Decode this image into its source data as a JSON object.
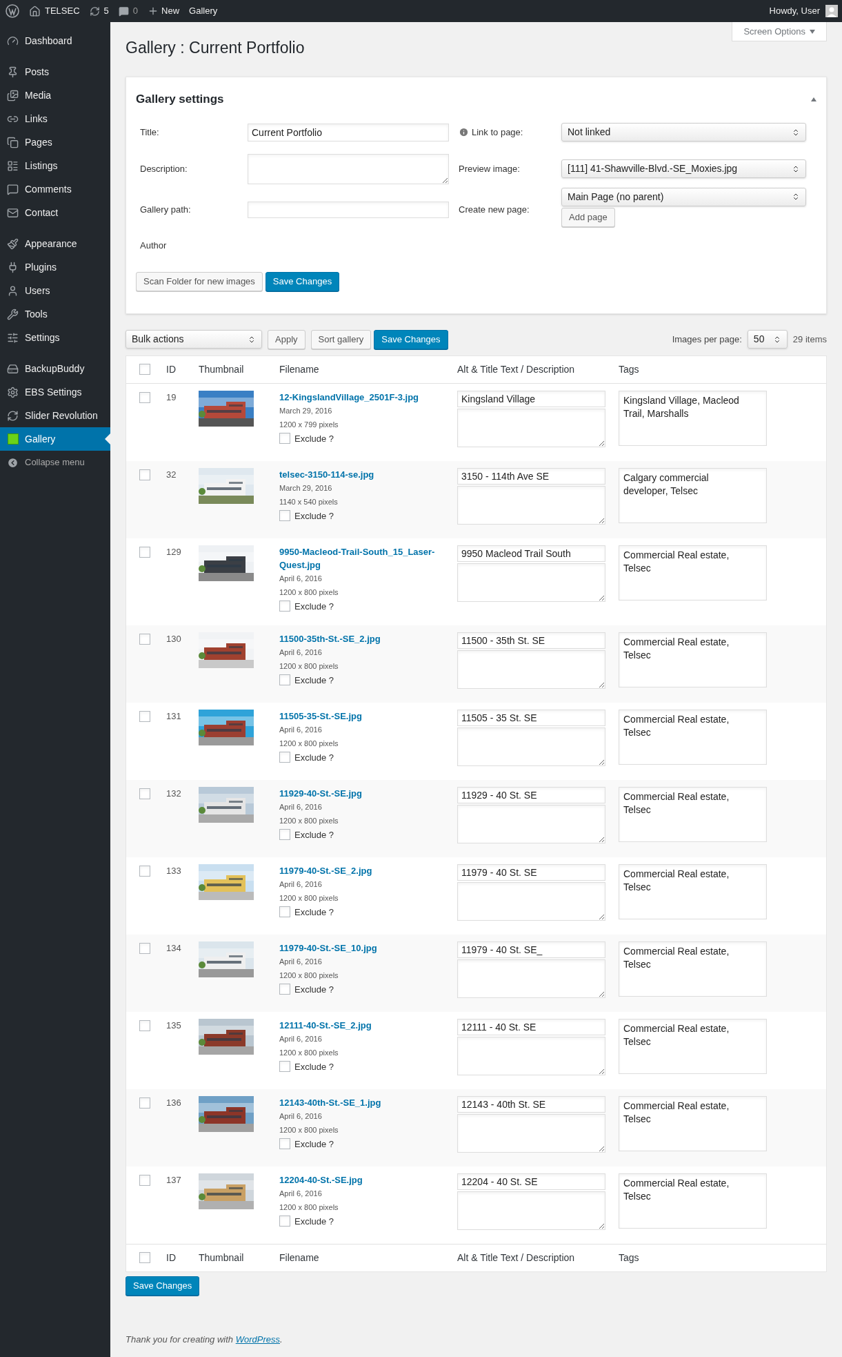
{
  "admin_bar": {
    "site": "TELSEC",
    "updates": "5",
    "comments": "0",
    "new": "New",
    "current": "Gallery",
    "greeting": "Howdy, User"
  },
  "sidebar": {
    "groups": [
      {
        "items": [
          {
            "label": "Dashboard",
            "kind": "dashboard",
            "selected": false
          }
        ]
      },
      {
        "items": [
          {
            "label": "Posts",
            "kind": "pin",
            "selected": false
          },
          {
            "label": "Media",
            "kind": "media",
            "selected": false
          },
          {
            "label": "Links",
            "kind": "link",
            "selected": false
          },
          {
            "label": "Pages",
            "kind": "pages",
            "selected": false
          },
          {
            "label": "Listings",
            "kind": "listings",
            "selected": false
          },
          {
            "label": "Comments",
            "kind": "comment",
            "selected": false
          },
          {
            "label": "Contact",
            "kind": "mail",
            "selected": false
          }
        ]
      },
      {
        "items": [
          {
            "label": "Appearance",
            "kind": "brush",
            "selected": false
          },
          {
            "label": "Plugins",
            "kind": "plug",
            "selected": false
          },
          {
            "label": "Users",
            "kind": "user",
            "selected": false
          },
          {
            "label": "Tools",
            "kind": "wrench",
            "selected": false
          },
          {
            "label": "Settings",
            "kind": "sliders",
            "selected": false
          }
        ]
      },
      {
        "items": [
          {
            "label": "BackupBuddy",
            "kind": "drive",
            "selected": false
          },
          {
            "label": "EBS Settings",
            "kind": "gear",
            "selected": false
          },
          {
            "label": "Slider Revolution",
            "kind": "refresh",
            "selected": false
          },
          {
            "label": "Gallery",
            "kind": "square",
            "selected": true
          }
        ]
      }
    ],
    "collapse": "Collapse menu"
  },
  "screen_options": "Screen Options",
  "page_title": "Gallery : Current Portfolio",
  "settings": {
    "heading": "Gallery settings",
    "title_label": "Title:",
    "title_value": "Current Portfolio",
    "description_label": "Description:",
    "path_label": "Gallery path:",
    "author_label": "Author",
    "link_label": "Link to page:",
    "link_value": "Not linked",
    "preview_label": "Preview image:",
    "preview_value": "[111] 41-Shawville-Blvd.-SE_Moxies.jpg",
    "create_label": "Create new page:",
    "create_value": "Main Page (no parent)",
    "add_page": "Add page",
    "scan_button": "Scan Folder for new images",
    "save_button": "Save Changes"
  },
  "toolbar": {
    "bulk": "Bulk actions",
    "apply": "Apply",
    "sort": "Sort gallery",
    "save": "Save Changes",
    "per_page_label": "Images per page:",
    "per_page": "50",
    "count": "29 items"
  },
  "table": {
    "select_all_checked": false,
    "footer_select_all_checked": false,
    "columns": [
      "ID",
      "Thumbnail",
      "Filename",
      "Alt & Title Text / Description",
      "Tags"
    ],
    "rows": [
      {
        "id": "19",
        "filename": "12-KingslandVillage_2501F-3.jpg",
        "date": "March 29, 2016",
        "size": "1200 x 799 pixels",
        "exclude_label": "Exclude ?",
        "exclude": false,
        "selected": false,
        "alt": "Kingsland Village",
        "tags": "Kingsland Village, Macleod Trail, Marshalls"
      },
      {
        "id": "32",
        "filename": "telsec-3150-114-se.jpg",
        "date": "March 29, 2016",
        "size": "1140 x 540 pixels",
        "exclude_label": "Exclude ?",
        "exclude": false,
        "selected": false,
        "alt": "3150 - 114th Ave SE",
        "tags": "Calgary commercial developer, Telsec"
      },
      {
        "id": "129",
        "filename": "9950-Macleod-Trail-South_15_Laser-Quest.jpg",
        "date": "April 6, 2016",
        "size": "1200 x 800 pixels",
        "exclude_label": "Exclude ?",
        "exclude": false,
        "selected": false,
        "alt": "9950 Macleod Trail South",
        "tags": "Commercial Real estate, Telsec"
      },
      {
        "id": "130",
        "filename": "11500-35th-St.-SE_2.jpg",
        "date": "April 6, 2016",
        "size": "1200 x 800 pixels",
        "exclude_label": "Exclude ?",
        "exclude": false,
        "selected": false,
        "alt": "11500 - 35th St. SE",
        "tags": "Commercial Real estate, Telsec"
      },
      {
        "id": "131",
        "filename": "11505-35-St.-SE.jpg",
        "date": "April 6, 2016",
        "size": "1200 x 800 pixels",
        "exclude_label": "Exclude ?",
        "exclude": false,
        "selected": false,
        "alt": "11505 - 35 St. SE",
        "tags": "Commercial Real estate, Telsec"
      },
      {
        "id": "132",
        "filename": "11929-40-St.-SE.jpg",
        "date": "April 6, 2016",
        "size": "1200 x 800 pixels",
        "exclude_label": "Exclude ?",
        "exclude": false,
        "selected": false,
        "alt": "11929 - 40 St. SE",
        "tags": "Commercial Real estate, Telsec"
      },
      {
        "id": "133",
        "filename": "11979-40-St.-SE_2.jpg",
        "date": "April 6, 2016",
        "size": "1200 x 800 pixels",
        "exclude_label": "Exclude ?",
        "exclude": false,
        "selected": false,
        "alt": "11979 - 40 St. SE",
        "tags": "Commercial Real estate, Telsec"
      },
      {
        "id": "134",
        "filename": "11979-40-St.-SE_10.jpg",
        "date": "April 6, 2016",
        "size": "1200 x 800 pixels",
        "exclude_label": "Exclude ?",
        "exclude": false,
        "selected": false,
        "alt": "11979 - 40 St. SE_",
        "tags": "Commercial Real estate, Telsec"
      },
      {
        "id": "135",
        "filename": "12111-40-St.-SE_2.jpg",
        "date": "April 6, 2016",
        "size": "1200 x 800 pixels",
        "exclude_label": "Exclude ?",
        "exclude": false,
        "selected": false,
        "alt": "12111 - 40 St. SE",
        "tags": "Commercial Real estate, Telsec"
      },
      {
        "id": "136",
        "filename": "12143-40th-St.-SE_1.jpg",
        "date": "April 6, 2016",
        "size": "1200 x 800 pixels",
        "exclude_label": "Exclude ?",
        "exclude": false,
        "selected": false,
        "alt": "12143 - 40th St. SE",
        "tags": "Commercial Real estate, Telsec"
      },
      {
        "id": "137",
        "filename": "12204-40-St.-SE.jpg",
        "date": "April 6, 2016",
        "size": "1200 x 800 pixels",
        "exclude_label": "Exclude ?",
        "exclude": false,
        "selected": false,
        "alt": "12204 - 40 St. SE",
        "tags": "Commercial Real estate, Telsec"
      }
    ],
    "footer_columns": [
      "ID",
      "Thumbnail",
      "Filename",
      "Alt & Title Text / Description",
      "Tags"
    ]
  },
  "bottom_save": "Save Changes",
  "footer": {
    "text": "Thank you for creating with ",
    "link": "WordPress",
    "end": "."
  }
}
